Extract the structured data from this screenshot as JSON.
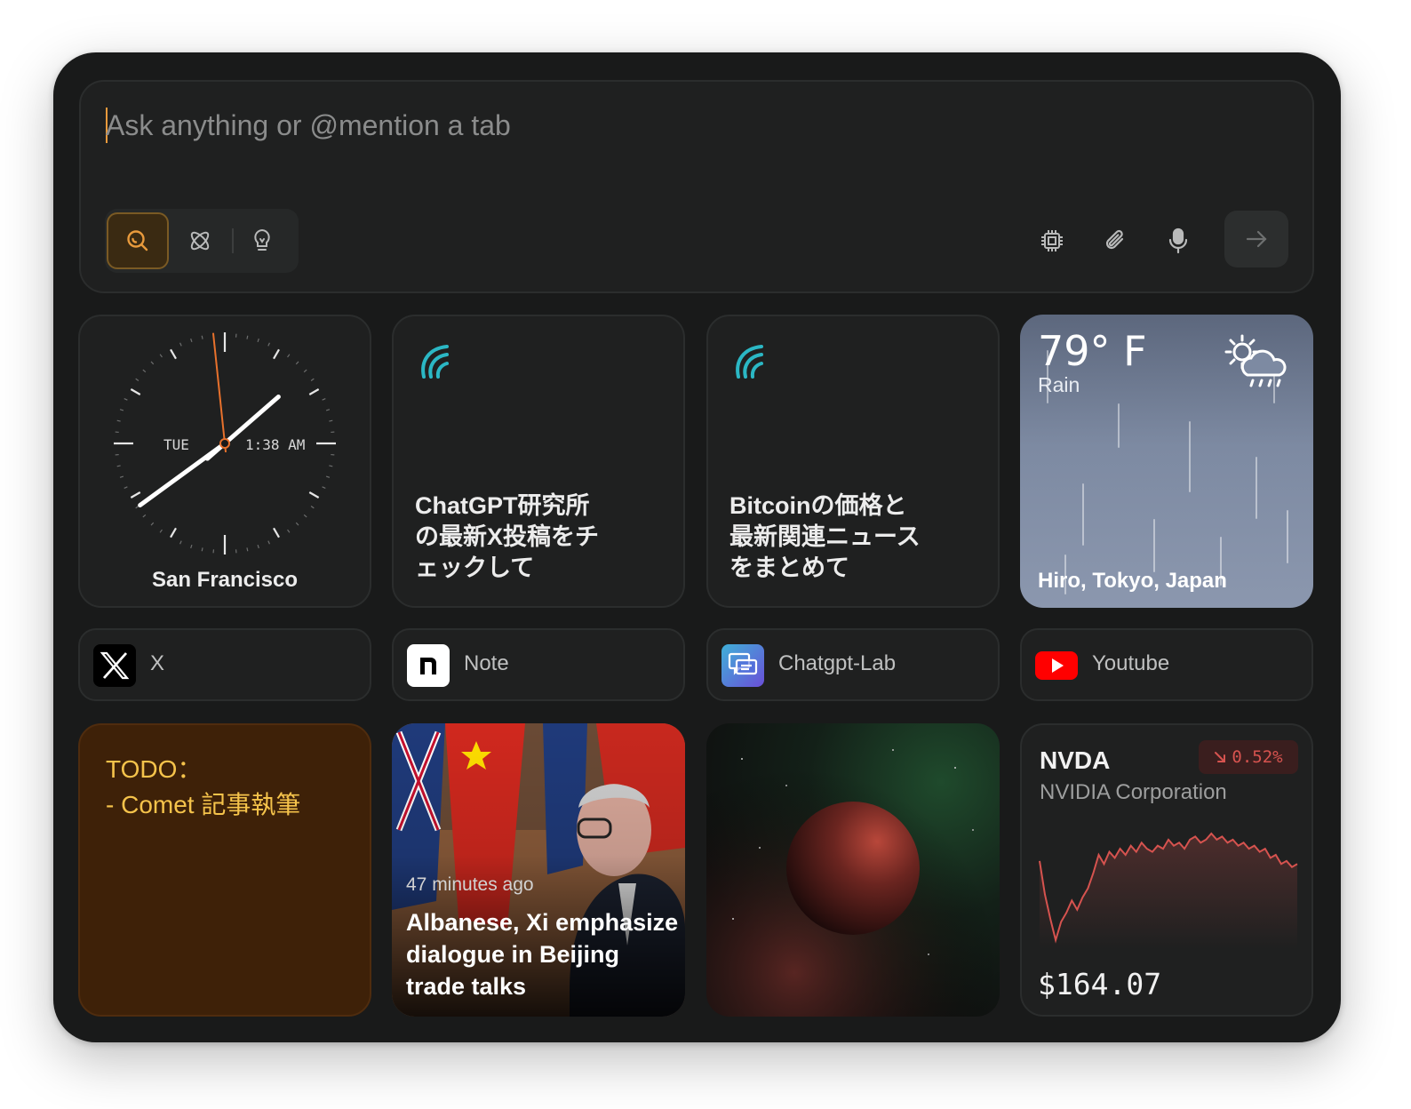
{
  "ask": {
    "placeholder": "Ask anything or @mention a tab",
    "modes": [
      "search",
      "research",
      "labs"
    ]
  },
  "clock": {
    "day": "TUE",
    "time": "1:38 AM",
    "city": "San Francisco",
    "hour": 1,
    "minute": 38,
    "second": 59
  },
  "prompts": [
    {
      "text": "ChatGPT研究所の最新X投稿をチェックして"
    },
    {
      "text": "Bitcoinの価格と最新関連ニュースをまとめて"
    }
  ],
  "weather": {
    "temp": "79° F",
    "condition": "Rain",
    "location": "Hiro, Tokyo, Japan",
    "icon": "sun-cloud-rain-icon"
  },
  "tabs": [
    {
      "label": "X",
      "icon": "x-logo-icon"
    },
    {
      "label": "Note",
      "icon": "note-logo-icon"
    },
    {
      "label": "Chatgpt-Lab",
      "icon": "chat-bubbles-icon"
    },
    {
      "label": "Youtube",
      "icon": "youtube-logo-icon"
    }
  ],
  "todo": {
    "text": "TODO：\n- Comet 記事執筆"
  },
  "news": {
    "time": "47 minutes ago",
    "title": "Albanese, Xi emphasize dialogue in Beijing trade talks"
  },
  "stock": {
    "symbol": "NVDA",
    "name": "NVIDIA Corporation",
    "change": "0.52%",
    "direction": "down",
    "price": "$164.07",
    "color": "#d6534f",
    "series": [
      166.2,
      165.1,
      164.3,
      163.6,
      164.2,
      164.5,
      164.9,
      164.6,
      165.0,
      165.3,
      165.8,
      166.4,
      166.1,
      166.5,
      166.3,
      166.6,
      166.4,
      166.7,
      166.5,
      166.8,
      166.6,
      166.5,
      166.7,
      166.6,
      166.9,
      166.7,
      166.8,
      166.6,
      166.9,
      167.0,
      166.8,
      166.9,
      167.1,
      166.9,
      167.0,
      166.8,
      166.9,
      166.7,
      166.8,
      166.6,
      166.7,
      166.5,
      166.6,
      166.3,
      166.4,
      166.1,
      166.2,
      166.0,
      166.1
    ]
  }
}
